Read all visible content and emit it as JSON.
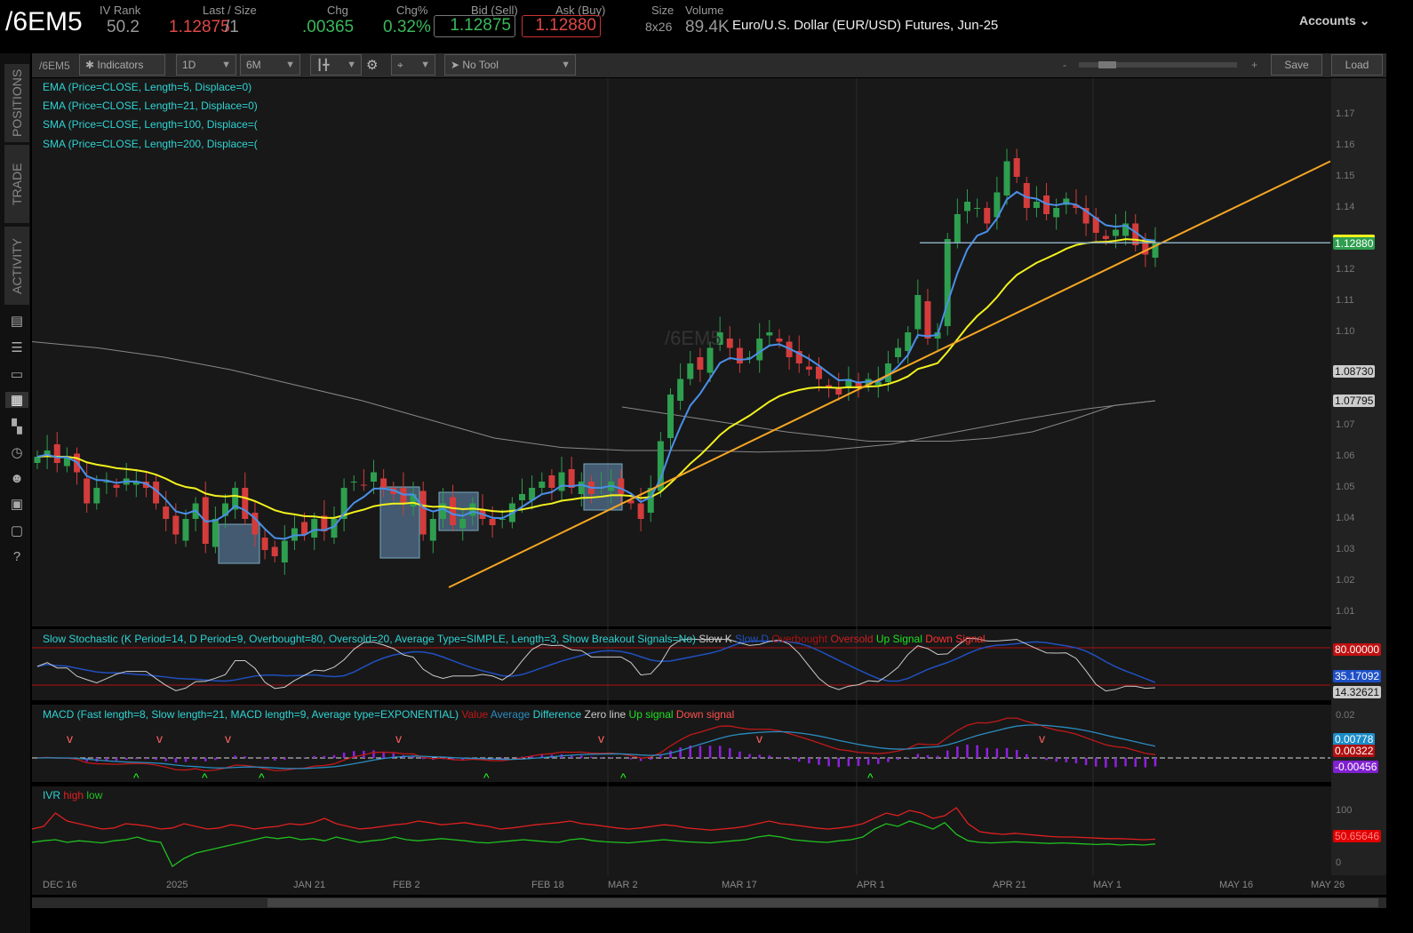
{
  "header": {
    "symbol": "/6EM5",
    "iv_rank_label": "IV Rank",
    "iv_rank": "50.2",
    "last_label": "Last / Size",
    "last": "1.12875",
    "last_size": "/1",
    "chg_label": "Chg",
    "chg": ".00365",
    "chgp_label": "Chg%",
    "chgp": "0.32%",
    "bid_label": "Bid (Sell)",
    "bid": "1.12875",
    "ask_label": "Ask (Buy)",
    "ask": "1.12880",
    "size_label": "Size",
    "size": "8x26",
    "volume_label": "Volume",
    "volume": "89.4K",
    "description": "Euro/U.S. Dollar (EUR/USD) Futures, Jun-25",
    "accounts": "Accounts"
  },
  "sidebar": {
    "tabs": [
      "POSITIONS",
      "TRADE",
      "ACTIVITY"
    ]
  },
  "toolbar": {
    "symbol": "/6EM5",
    "indicators": "Indicators",
    "aggregation": "1D",
    "range": "6M",
    "tool": "No Tool",
    "zoom_minus": "-",
    "zoom_plus": "+",
    "save": "Save",
    "load": "Load"
  },
  "studies": [
    "EMA (Price=CLOSE, Length=5, Displace=0)",
    "EMA (Price=CLOSE, Length=21, Displace=0)",
    "SMA (Price=CLOSE, Length=100, Displace=(",
    "SMA (Price=CLOSE, Length=200, Displace=("
  ],
  "watermark": "/6EM5",
  "stoch": {
    "title": "Slow Stochastic (K Period=14, D Period=9, Overbought=80, Oversold=20, Average Type=SIMPLE, Length=3, Show Breakout Signals=No)",
    "legend": [
      "Slow K",
      "Slow D",
      "Overbought",
      "Oversold",
      "Up Signal",
      "Down Signal"
    ],
    "tags": [
      "80.00000",
      "35.17092",
      "14.32621"
    ]
  },
  "macd": {
    "title": "MACD (Fast length=8, Slow length=21, MACD length=9, Average type=EXPONENTIAL)",
    "legend": [
      "Value",
      "Average",
      "Difference",
      "Zero line",
      "Up signal",
      "Down signal"
    ],
    "tick": "0.02",
    "tags": [
      "0.00778",
      "0.00322",
      "-0.00456"
    ]
  },
  "ivr": {
    "title": "IVR",
    "legend": [
      "high",
      "low"
    ],
    "ticks": [
      "100",
      "0"
    ],
    "tag": "50.65646",
    "high": [
      70,
      75,
      100,
      85,
      80,
      75,
      70,
      72,
      80,
      78,
      75,
      70,
      72,
      80,
      75,
      70,
      72,
      78,
      75,
      70,
      73,
      75,
      80,
      78,
      82,
      90,
      80,
      75,
      70,
      72,
      75,
      78,
      80,
      85,
      82,
      78,
      80,
      82,
      78,
      75,
      70,
      72,
      75,
      78,
      80,
      82,
      85,
      80,
      78,
      75,
      72,
      70,
      72,
      75,
      78,
      76,
      72,
      70,
      68,
      70,
      72,
      75,
      80,
      85,
      80,
      78,
      75,
      72,
      70,
      72,
      75,
      80,
      90,
      100,
      95,
      105,
      100,
      90,
      95,
      110,
      80,
      65,
      62,
      60,
      62,
      60,
      58,
      56,
      55,
      55,
      54,
      53,
      52,
      52,
      51,
      50,
      51
    ],
    "low": [
      45,
      48,
      50,
      45,
      48,
      46,
      44,
      48,
      50,
      55,
      48,
      45,
      0,
      15,
      25,
      30,
      35,
      40,
      45,
      50,
      55,
      52,
      55,
      50,
      52,
      48,
      55,
      50,
      45,
      48,
      50,
      55,
      50,
      48,
      50,
      52,
      50,
      48,
      45,
      44,
      46,
      48,
      50,
      48,
      46,
      45,
      50,
      52,
      48,
      46,
      45,
      44,
      46,
      48,
      50,
      48,
      46,
      45,
      44,
      46,
      48,
      50,
      55,
      58,
      55,
      50,
      48,
      46,
      45,
      48,
      50,
      55,
      70,
      80,
      75,
      85,
      78,
      70,
      82,
      60,
      48,
      45,
      44,
      45,
      46,
      45,
      44,
      43,
      44,
      43,
      42,
      41,
      42,
      40,
      41,
      40,
      42
    ]
  },
  "price_axis": {
    "ticks": [
      "1.17",
      "1.16",
      "1.15",
      "1.14",
      "1.12",
      "1.11",
      "1.10",
      "1.07",
      "1.06",
      "1.05",
      "1.04",
      "1.03",
      "1.02",
      "1.01"
    ],
    "tags": {
      "last": "1.12880",
      "sma100": "1.08730",
      "sma200": "1.07795"
    }
  },
  "date_axis": [
    "DEC 16",
    "2025",
    "JAN 21",
    "FEB 2",
    "FEB 18",
    "MAR 2",
    "MAR 17",
    "APR 1",
    "APR 21",
    "MAY 1",
    "MAY 16",
    "MAY 26"
  ],
  "colors": {
    "up": "#2e9e4f",
    "down": "#d43c3c",
    "ema5": "#4a8fe8",
    "ema21": "#f2f21e",
    "sma": "#888888",
    "trend": "#f5a623",
    "cyan": "#2fd3d3"
  },
  "chart_data": {
    "type": "candlestick",
    "symbol": "/6EM5",
    "closes": [
      1.06,
      1.062,
      1.058,
      1.06,
      1.055,
      1.045,
      1.05,
      1.052,
      1.05,
      1.053,
      1.052,
      1.05,
      1.045,
      1.04,
      1.035,
      1.04,
      1.045,
      1.032,
      1.04,
      1.045,
      1.05,
      1.04,
      1.035,
      1.03,
      1.028,
      1.033,
      1.037,
      1.035,
      1.04,
      1.036,
      1.04,
      1.05,
      1.052,
      1.051,
      1.055,
      1.05,
      1.048,
      1.045,
      1.048,
      1.035,
      1.04,
      1.045,
      1.038,
      1.04,
      1.045,
      1.04,
      1.038,
      1.04,
      1.045,
      1.048,
      1.05,
      1.052,
      1.05,
      1.055,
      1.05,
      1.052,
      1.048,
      1.05,
      1.052,
      1.048,
      1.045,
      1.04,
      1.05,
      1.065,
      1.08,
      1.085,
      1.09,
      1.088,
      1.095,
      1.1,
      1.095,
      1.09,
      1.092,
      1.098,
      1.1,
      1.097,
      1.092,
      1.09,
      1.088,
      1.085,
      1.082,
      1.08,
      1.085,
      1.082,
      1.085,
      1.084,
      1.09,
      1.095,
      1.1,
      1.112,
      1.098,
      1.1,
      1.13,
      1.138,
      1.142,
      1.14,
      1.135,
      1.145,
      1.155,
      1.15,
      1.14,
      1.142,
      1.138,
      1.14,
      1.143,
      1.14,
      1.135,
      1.132,
      1.13,
      1.133,
      1.135,
      1.128,
      1.125,
      1.1288
    ],
    "sma100_points": [
      1.076,
      1.074,
      1.072,
      1.07,
      1.068,
      1.0665,
      1.065,
      1.065,
      1.065,
      1.066,
      1.068,
      1.072,
      1.0765,
      1.078
    ],
    "sma200_points": [
      1.097,
      1.095,
      1.092,
      1.088,
      1.083,
      1.078,
      1.072,
      1.066,
      1.063,
      1.062,
      1.062,
      1.0615,
      1.062,
      1.064,
      1.068,
      1.072,
      1.0755,
      1.078
    ],
    "trendline": [
      [
        1.018
      ],
      [
        1.155
      ]
    ],
    "support_level": 1.1288,
    "ylim": [
      1.005,
      1.175
    ]
  }
}
